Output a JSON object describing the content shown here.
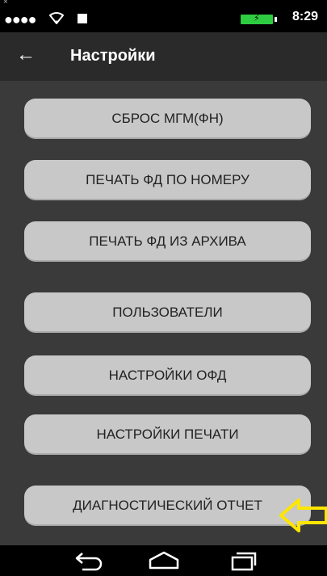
{
  "status_bar": {
    "time": "8:29",
    "signal_icon": "signal-dots-icon",
    "wifi_icon": "wifi-icon",
    "battery_icon": "battery-charging-icon",
    "battery_color": "#2ecc40"
  },
  "app_bar": {
    "title": "Настройки",
    "back_icon": "arrow-left-icon"
  },
  "menu": {
    "items": [
      {
        "label": "СБРОС МГМ(ФН)"
      },
      {
        "label": "ПЕЧАТЬ ФД ПО НОМЕРУ"
      },
      {
        "label": "ПЕЧАТЬ ФД ИЗ АРХИВА"
      },
      {
        "label": "ПОЛЬЗОВАТЕЛИ"
      },
      {
        "label": "НАСТРОЙКИ ОФД"
      },
      {
        "label": "НАСТРОЙКИ ПЕЧАТИ"
      },
      {
        "label": "ДИАГНОСТИЧЕСКИЙ ОТЧЕТ"
      }
    ],
    "button_color": "#c8c8c8"
  },
  "annotation": {
    "icon": "yellow-arrow-left-icon",
    "color": "#ffe600"
  },
  "nav_bar": {
    "back_icon": "nav-back-icon",
    "home_icon": "nav-home-icon",
    "recents_icon": "nav-recents-icon"
  }
}
